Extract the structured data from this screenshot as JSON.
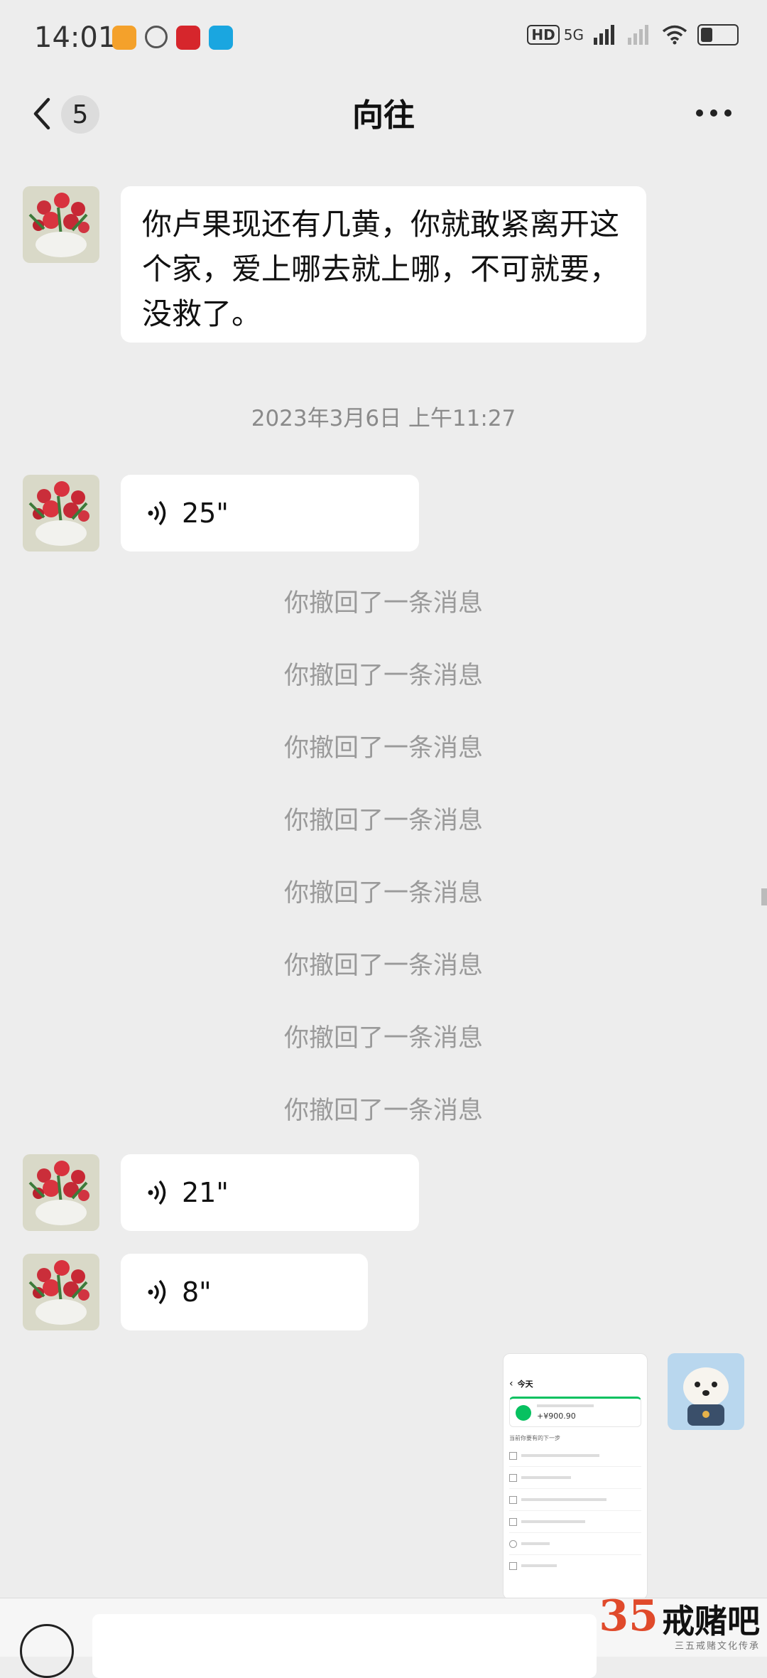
{
  "status": {
    "time": "14:01",
    "network": "5G",
    "hd": "HD",
    "sim": "1"
  },
  "header": {
    "unread_count": "5",
    "title": "向往"
  },
  "messages": {
    "text1": "你卢果现还有几黄，你就敢紧离开这个家，爱上哪去就上哪，不可就要，没救了。",
    "timestamp": "2023年3月6日 上午11:27",
    "voice1": "25\"",
    "recalls": [
      "你撤回了一条消息",
      "你撤回了一条消息",
      "你撤回了一条消息",
      "你撤回了一条消息",
      "你撤回了一条消息",
      "你撤回了一条消息",
      "你撤回了一条消息",
      "你撤回了一条消息"
    ],
    "voice2": "21\"",
    "voice3": "8\""
  },
  "screenshot": {
    "title": "今天",
    "amount": "+¥900.90",
    "section": "当前你要有的下一步"
  },
  "watermark": {
    "number": "35",
    "title": "戒赌吧",
    "subtitle": "三五戒赌文化传承"
  },
  "colors": {
    "background": "#ededed",
    "bubble": "#ffffff",
    "system_text": "#9a9a9a",
    "accent_green": "#07c160"
  }
}
